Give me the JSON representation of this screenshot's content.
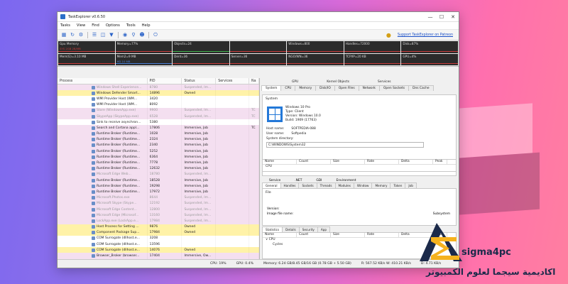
{
  "window": {
    "title": "TaskExplorer v0.6.50"
  },
  "menu": [
    "Tasks",
    "View",
    "Find",
    "Options",
    "Tools",
    "Help"
  ],
  "support_link": "Support TaskExplorer on Patreon",
  "graphs": [
    {
      "label": "Gpu Memory",
      "sub": "SYS 2GB 2B/MB",
      "line": "red"
    },
    {
      "label": "Memory=77%",
      "sub": "",
      "line": "red"
    },
    {
      "label": "Objects=24",
      "sub": "",
      "line": "green"
    },
    {
      "label": "",
      "sub": "",
      "line": "red"
    },
    {
      "label": "Windows=800",
      "sub": "",
      "line": "red"
    },
    {
      "label": "Handles=72000",
      "sub": "",
      "line": "red"
    },
    {
      "label": "Disk=87%",
      "sub": "",
      "line": "red"
    },
    {
      "label": "Mem(G)=3.10 MB",
      "sub": "",
      "line": "red"
    },
    {
      "label": "Mem2=9 MB",
      "sub": "HD 10 MB",
      "line": "blue"
    },
    {
      "label": "Dent=36",
      "sub": "",
      "line": "red"
    },
    {
      "label": "Server=36",
      "sub": "",
      "line": "red"
    },
    {
      "label": "NGO/WN=36",
      "sub": "",
      "line": "red"
    },
    {
      "label": "TCP/IP=20 KB",
      "sub": "",
      "line": "red"
    },
    {
      "label": "GPU=4%",
      "sub": "",
      "line": "red"
    },
    {
      "label": "CPU=9%",
      "sub": "",
      "line": "red"
    }
  ],
  "proc_columns": [
    "Process",
    "PID",
    "Status",
    "Services",
    "Na"
  ],
  "processes": [
    {
      "name": "Windows Shell Experience...",
      "pid": "8780",
      "status": "Suspended, Im...",
      "services": "",
      "n": "",
      "bg": "#f4dff0",
      "faded": true
    },
    {
      "name": "Windows Defender Smart...",
      "pid": "14896",
      "status": "Owned",
      "services": "",
      "n": "",
      "bg": "#fff2a8",
      "faded": false
    },
    {
      "name": "WMI Provider Host (WM...",
      "pid": "3420",
      "status": "",
      "services": "",
      "n": "",
      "bg": "#ffffff",
      "faded": false
    },
    {
      "name": "WMI Provider Host (WM...",
      "pid": "8092",
      "status": "",
      "services": "",
      "n": "",
      "bg": "#ffffff",
      "faded": false
    },
    {
      "name": "Store (WindowsApp.exe)",
      "pid": "9900",
      "status": "Suspended, Im...",
      "services": "",
      "n": "TC",
      "bg": "#f4dff0",
      "faded": true
    },
    {
      "name": "SkypeApp (SkypeApp.exe)",
      "pid": "6528",
      "status": "Suspended, Im...",
      "services": "",
      "n": "TC",
      "bg": "#f4dff0",
      "faded": true
    },
    {
      "name": "Sink to receive asynchron...",
      "pid": "5380",
      "status": "",
      "services": "",
      "n": "",
      "bg": "#ffffff",
      "faded": false
    },
    {
      "name": "Search and Cortana appl...",
      "pid": "17806",
      "status": "Immersive, Job",
      "services": "",
      "n": "TC",
      "bg": "#f4dff0",
      "faded": false
    },
    {
      "name": "Runtime Broker (Runtime...",
      "pid": "1028",
      "status": "Immersive, Job",
      "services": "",
      "n": "",
      "bg": "#f4dff0",
      "faded": false
    },
    {
      "name": "Runtime Broker (Runtime...",
      "pid": "2324",
      "status": "Immersive, Job",
      "services": "",
      "n": "",
      "bg": "#f4dff0",
      "faded": false
    },
    {
      "name": "Runtime Broker (Runtime...",
      "pid": "2340",
      "status": "Immersive, Job",
      "services": "",
      "n": "",
      "bg": "#f4dff0",
      "faded": false
    },
    {
      "name": "Runtime Broker (Runtime...",
      "pid": "5252",
      "status": "Immersive, Job",
      "services": "",
      "n": "",
      "bg": "#f4dff0",
      "faded": false
    },
    {
      "name": "Runtime Broker (Runtime...",
      "pid": "6364",
      "status": "Immersive, Job",
      "services": "",
      "n": "",
      "bg": "#f4dff0",
      "faded": false
    },
    {
      "name": "Runtime Broker (Runtime...",
      "pid": "7778",
      "status": "Immersive, Job",
      "services": "",
      "n": "",
      "bg": "#f4dff0",
      "faded": false
    },
    {
      "name": "Runtime Broker (Runtime...",
      "pid": "12632",
      "status": "Immersive, Job",
      "services": "",
      "n": "",
      "bg": "#f4dff0",
      "faded": false
    },
    {
      "name": "Microsoft Edge Web...",
      "pid": "18780",
      "status": "Suspended, Im...",
      "services": "",
      "n": "",
      "bg": "#f4dff0",
      "faded": true
    },
    {
      "name": "Runtime Broker (Runtime...",
      "pid": "18528",
      "status": "Immersive, Job",
      "services": "",
      "n": "",
      "bg": "#f4dff0",
      "faded": false
    },
    {
      "name": "Runtime Broker (Runtime...",
      "pid": "19298",
      "status": "Immersive, Job",
      "services": "",
      "n": "",
      "bg": "#f4dff0",
      "faded": false
    },
    {
      "name": "Runtime Broker (Runtime...",
      "pid": "17972",
      "status": "Immersive, Job",
      "services": "",
      "n": "",
      "bg": "#f4dff0",
      "faded": false
    },
    {
      "name": "Microsoft.Photos.exe",
      "pid": "8644",
      "status": "Suspended, Im...",
      "services": "",
      "n": "",
      "bg": "#f4dff0",
      "faded": true
    },
    {
      "name": "Microsoft Skype (Skype...",
      "pid": "12192",
      "status": "Suspended, Im...",
      "services": "",
      "n": "",
      "bg": "#f4dff0",
      "faded": true
    },
    {
      "name": "Microsoft Edge Content...",
      "pid": "12800",
      "status": "Suspended, Im...",
      "services": "",
      "n": "",
      "bg": "#f4dff0",
      "faded": true
    },
    {
      "name": "Microsoft Edge (Microsof...",
      "pid": "13160",
      "status": "Suspended, Im...",
      "services": "",
      "n": "",
      "bg": "#f4dff0",
      "faded": true
    },
    {
      "name": "LockApp.exe (LockApp.e...",
      "pid": "17984",
      "status": "Suspended, Im...",
      "services": "",
      "n": "",
      "bg": "#f4dff0",
      "faded": true
    },
    {
      "name": "Host Process for Setting ...",
      "pid": "9876",
      "status": "Owned",
      "services": "",
      "n": "",
      "bg": "#fff2a8",
      "faded": false
    },
    {
      "name": "Component Package Sup...",
      "pid": "17984",
      "status": "Owned",
      "services": "",
      "n": "",
      "bg": "#fff2a8",
      "faded": false
    },
    {
      "name": "COM Surrogate (dllhost.e...",
      "pid": "3208",
      "status": "",
      "services": "",
      "n": "",
      "bg": "#ffffff",
      "faded": false
    },
    {
      "name": "COM Surrogate (dllhost.e...",
      "pid": "13596",
      "status": "",
      "services": "",
      "n": "",
      "bg": "#ffffff",
      "faded": false
    },
    {
      "name": "COM Surrogate (dllhost.e...",
      "pid": "14076",
      "status": "Owned",
      "services": "",
      "n": "",
      "bg": "#fff2a8",
      "faded": false
    },
    {
      "name": "Browser_Broker (browser...",
      "pid": "17404",
      "status": "Immersive, Ow...",
      "services": "",
      "n": "",
      "bg": "#f4dff0",
      "faded": false
    }
  ],
  "details": {
    "tab_groups": [
      "GPU",
      "Kernel Objects",
      "Services"
    ],
    "tabs": [
      "System",
      "CPU",
      "Memory",
      "Disk/IO",
      "Open Files",
      "Network",
      "Open Sockets",
      "Dns Cache"
    ],
    "system_label": "System",
    "os_name": "Windows 10 Pro",
    "os_type": "Type:   Client",
    "os_version": "Version: Windows 10.0",
    "os_build": "Build:   1909 (17763)",
    "host_name_key": "Host name:",
    "host_name_val": "SOFTPEDIA-088",
    "user_name_key": "User name:",
    "user_name_val": "Softpedia",
    "sysdir_key": "System directory:",
    "sysdir_val": "C:\\WINDOWS\\System32",
    "grid_cols": [
      "Name",
      "Count",
      "Size",
      "Rate",
      "Delta",
      "Peak"
    ],
    "grid_row1": "CPU",
    "grid_row2": "Context",
    "lower_groups": [
      "Service",
      ".NET",
      "GDI",
      "Environment"
    ],
    "lower_tabs": [
      "General",
      "Handles",
      "Sockets",
      "Threads",
      "Modules",
      "Window",
      "Memory",
      "Token",
      "Job"
    ],
    "file_label": "File",
    "version_label": "Version:",
    "image_label": "Image file name:",
    "subsystem_label": "Subsystem",
    "stat_tabs": [
      "Statistics",
      "Details",
      "Security",
      "App"
    ],
    "stat_cols": [
      "Name",
      "Count",
      "Size",
      "Rate",
      "Delta",
      "Peak"
    ],
    "stat_row1": "CPU",
    "stat_row2": "Cycles"
  },
  "status": {
    "cpu": "CPU: 19%",
    "gpu": "GPU: 0.4%",
    "memory": "Memory: 6.24 GB/8.45 GB/16 GB (0.78 GB + 5.50 GB)",
    "rate": "R: 567.52 KB/s W: 410.21 KB/s",
    "disk": "D: 4.71 KB/s"
  },
  "brand": {
    "logo_text": "sigma4pc",
    "arabic": "اكاديمية سيجما لعلوم الكمبيوتر"
  }
}
